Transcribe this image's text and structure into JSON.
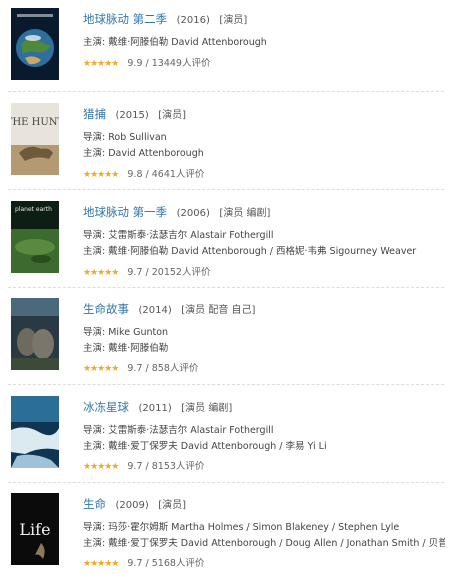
{
  "items": [
    {
      "title": "地球脉动 第二季",
      "year": "(2016)",
      "role": "[演员]",
      "lines": [
        "主演: 戴维·阿滕伯勒 David Attenborough"
      ],
      "rating": "9.9",
      "votes": "13449人评价",
      "poster": "earth-globe-poster"
    },
    {
      "title": "猎捕",
      "year": "(2015)",
      "role": "[演员]",
      "lines": [
        "导演: Rob Sullivan",
        "主演: David Attenborough"
      ],
      "rating": "9.8",
      "votes": "4641人评价",
      "poster": "hunt-poster",
      "poster_text": "THE HUNT"
    },
    {
      "title": "地球脉动 第一季",
      "year": "(2006)",
      "role": "[演员 编剧]",
      "lines": [
        "导演: 艾雷斯泰·法瑟吉尔 Alastair Fothergill",
        "主演: 戴维·阿滕伯勒 David Attenborough / 西格妮·韦弗 Sigourney Weaver"
      ],
      "rating": "9.7",
      "votes": "20152人评价",
      "poster": "planet-earth-poster",
      "poster_text": "planet earth"
    },
    {
      "title": "生命故事",
      "year": "(2014)",
      "role": "[演员 配音 自己]",
      "lines": [
        "导演: Mike Gunton",
        "主演: 戴维·阿滕伯勒"
      ],
      "rating": "9.7",
      "votes": "858人评价",
      "poster": "life-story-poster"
    },
    {
      "title": "冰冻星球",
      "year": "(2011)",
      "role": "[演员 编剧]",
      "lines": [
        "导演: 艾雷斯泰·法瑟吉尔 Alastair Fothergill",
        "主演: 戴维·爱丁保罗夫 David Attenborough / 李易 Yi Li"
      ],
      "rating": "9.7",
      "votes": "8153人评价",
      "poster": "frozen-planet-poster"
    },
    {
      "title": "生命",
      "year": "(2009)",
      "role": "[演员]",
      "lines": [
        "导演: 玛莎·霍尔姆斯 Martha Holmes / Simon Blakeney / Stephen Lyle",
        "主演: 戴维·爱丁保罗夫 David Attenborough / Doug Allen / Jonathan Smith / 贝普..."
      ],
      "rating": "9.7",
      "votes": "5168人评价",
      "poster": "life-poster",
      "poster_text": "Life"
    }
  ],
  "stars": "★★★★★",
  "colors": {
    "link": "#3377aa",
    "star": "#f5a623"
  }
}
